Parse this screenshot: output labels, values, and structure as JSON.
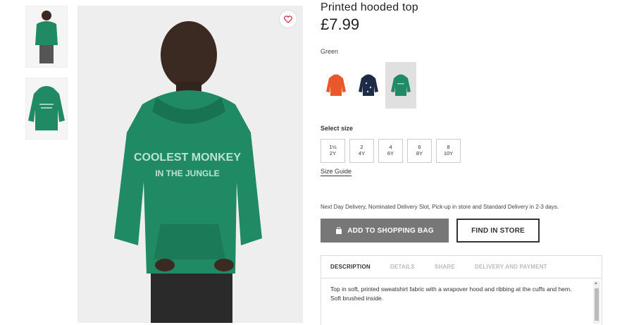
{
  "product": {
    "title": "Printed hooded top",
    "price": "£7.99",
    "color_label": "Green",
    "graphic_text_line1": "COOLEST MONKEY",
    "graphic_text_line2": "IN THE JUNGLE"
  },
  "colors": {
    "accent_green": "#1f8a63",
    "swatch_orange": "#e8582a",
    "swatch_navy": "#1d2b45",
    "button_gray": "#777777"
  },
  "swatches": [
    {
      "name": "orange"
    },
    {
      "name": "navy"
    },
    {
      "name": "green",
      "selected": true
    }
  ],
  "size_label": "Select size",
  "sizes": [
    {
      "top": "1½",
      "bottom": "2Y"
    },
    {
      "top": "2",
      "bottom": "4Y"
    },
    {
      "top": "4",
      "bottom": "6Y"
    },
    {
      "top": "6",
      "bottom": "8Y"
    },
    {
      "top": "8",
      "bottom": "10Y"
    }
  ],
  "size_guide": "Size Guide",
  "delivery_text": "Next Day Delivery, Nominated Delivery Slot, Pick-up in store and Standard Delivery in 2-3 days.",
  "buttons": {
    "add_to_bag": "ADD TO SHOPPING BAG",
    "find_in_store": "FIND IN STORE"
  },
  "tabs": [
    {
      "label": "DESCRIPTION",
      "active": true
    },
    {
      "label": "DETAILS"
    },
    {
      "label": "SHARE"
    },
    {
      "label": "DELIVERY AND PAYMENT"
    }
  ],
  "description": "Top in soft, printed sweatshirt fabric with a wrapover hood and ribbing at the cuffs and hem. Soft brushed inside."
}
